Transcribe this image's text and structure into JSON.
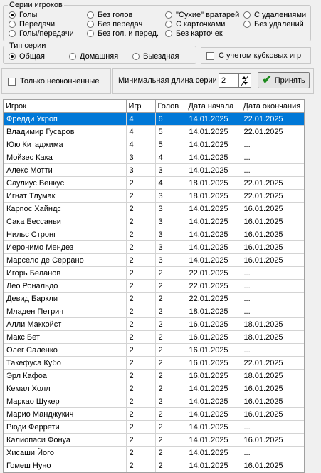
{
  "series_group": {
    "title": "Серии игроков",
    "options": [
      {
        "label": "Голы",
        "checked": true
      },
      {
        "label": "Передачи",
        "checked": false
      },
      {
        "label": "Голы/передачи",
        "checked": false
      },
      {
        "label": "Без голов",
        "checked": false
      },
      {
        "label": "Без передач",
        "checked": false
      },
      {
        "label": "Без гол. и перед.",
        "checked": false
      },
      {
        "label": "\"Сухие\" вратарей",
        "checked": false
      },
      {
        "label": "С карточками",
        "checked": false
      },
      {
        "label": "Без карточек",
        "checked": false
      },
      {
        "label": "С удалениями",
        "checked": false
      },
      {
        "label": "Без удалений",
        "checked": false
      }
    ]
  },
  "type_group": {
    "title": "Тип серии",
    "options": [
      {
        "label": "Общая",
        "checked": true
      },
      {
        "label": "Домашняя",
        "checked": false
      },
      {
        "label": "Выездная",
        "checked": false
      }
    ]
  },
  "cup_checkbox": {
    "label": "С учетом кубковых игр",
    "checked": false
  },
  "unfinished_checkbox": {
    "label": "Только неоконченные",
    "checked": false
  },
  "min_length": {
    "label": "Минимальная длина серии",
    "value": "2"
  },
  "accept_button": {
    "label": "Принять"
  },
  "table": {
    "columns": [
      "Игрок",
      "Игр",
      "Голов",
      "Дата начала",
      "Дата окончания"
    ],
    "selected_row": 0,
    "rows": [
      [
        "Фредди Укроп",
        "4",
        "6",
        "14.01.2025",
        "22.01.2025"
      ],
      [
        "Владимир Гусаров",
        "4",
        "5",
        "14.01.2025",
        "22.01.2025"
      ],
      [
        "Юю Китаджима",
        "4",
        "5",
        "14.01.2025",
        "..."
      ],
      [
        "Мойзес Кака",
        "3",
        "4",
        "14.01.2025",
        "..."
      ],
      [
        "Алекс Мотти",
        "3",
        "3",
        "14.01.2025",
        "..."
      ],
      [
        "Саулиус Венкус",
        "2",
        "4",
        "18.01.2025",
        "22.01.2025"
      ],
      [
        "Игнат Тлумак",
        "2",
        "3",
        "18.01.2025",
        "22.01.2025"
      ],
      [
        "Карпос Хайндс",
        "2",
        "3",
        "14.01.2025",
        "16.01.2025"
      ],
      [
        "Сака Бессанви",
        "2",
        "3",
        "14.01.2025",
        "16.01.2025"
      ],
      [
        "Нильс Стронг",
        "2",
        "3",
        "14.01.2025",
        "16.01.2025"
      ],
      [
        "Иеронимо Мендез",
        "2",
        "3",
        "14.01.2025",
        "16.01.2025"
      ],
      [
        "Марсело де Серрано",
        "2",
        "3",
        "14.01.2025",
        "16.01.2025"
      ],
      [
        "Игорь Беланов",
        "2",
        "2",
        "22.01.2025",
        "..."
      ],
      [
        "Лео Рональдо",
        "2",
        "2",
        "22.01.2025",
        "..."
      ],
      [
        "Девид Баркли",
        "2",
        "2",
        "22.01.2025",
        "..."
      ],
      [
        "Младен Петрич",
        "2",
        "2",
        "18.01.2025",
        "..."
      ],
      [
        "Алли Маккойст",
        "2",
        "2",
        "16.01.2025",
        "18.01.2025"
      ],
      [
        "Макс Бет",
        "2",
        "2",
        "16.01.2025",
        "18.01.2025"
      ],
      [
        "Олег Саленко",
        "2",
        "2",
        "16.01.2025",
        "..."
      ],
      [
        "Такефуса Кубо",
        "2",
        "2",
        "16.01.2025",
        "22.01.2025"
      ],
      [
        "Эрл Кафоа",
        "2",
        "2",
        "16.01.2025",
        "18.01.2025"
      ],
      [
        "Кемал Холл",
        "2",
        "2",
        "14.01.2025",
        "16.01.2025"
      ],
      [
        "Маркао Шукер",
        "2",
        "2",
        "14.01.2025",
        "16.01.2025"
      ],
      [
        "Марио Манджукич",
        "2",
        "2",
        "14.01.2025",
        "16.01.2025"
      ],
      [
        "Рюди Феррети",
        "2",
        "2",
        "14.01.2025",
        "..."
      ],
      [
        "Калиопаси Фонуа",
        "2",
        "2",
        "14.01.2025",
        "16.01.2025"
      ],
      [
        "Хисаши Його",
        "2",
        "2",
        "14.01.2025",
        "..."
      ],
      [
        "Гомеш Нуно",
        "2",
        "2",
        "14.01.2025",
        "16.01.2025"
      ]
    ]
  }
}
